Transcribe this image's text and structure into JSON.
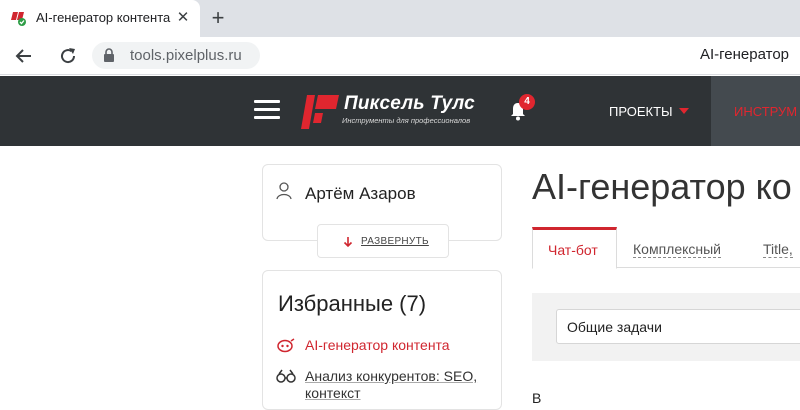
{
  "browser": {
    "tab_title": "AI-генератор контента",
    "tab_close": "✕",
    "new_tab": "+",
    "url": "tools.pixelplus.ru",
    "page_title_right": "AI-генератор"
  },
  "header": {
    "logo_name": "Пиксель Тулс",
    "logo_tagline": "Инструменты для профессионалов",
    "notification_count": "4",
    "menu_projects": "ПРОЕКТЫ",
    "menu_tools": "ИНСТРУМ",
    "accent_color": "#e0262f",
    "bg_color": "#2f3336"
  },
  "sidebar": {
    "user_name": "Артём Азаров",
    "expand_label": "РАЗВЕРНУТЬ",
    "favorites_title": "Избранные (7)",
    "favorites": [
      {
        "label": "AI-генератор контента",
        "icon": "ai-icon",
        "active": true
      },
      {
        "label": "Анализ конкурентов: SEO,",
        "icon": "binoculars-icon",
        "active": false
      },
      {
        "label": "контекст",
        "icon": "",
        "active": false
      }
    ]
  },
  "main": {
    "title": "AI-генератор ко",
    "tabs": [
      {
        "label": "Чат-бот",
        "active": true
      },
      {
        "label": "Комплексный",
        "active": false
      },
      {
        "label": "Title,",
        "active": false
      }
    ],
    "select_value": "Общие задачи",
    "bottom_partial": "В"
  }
}
